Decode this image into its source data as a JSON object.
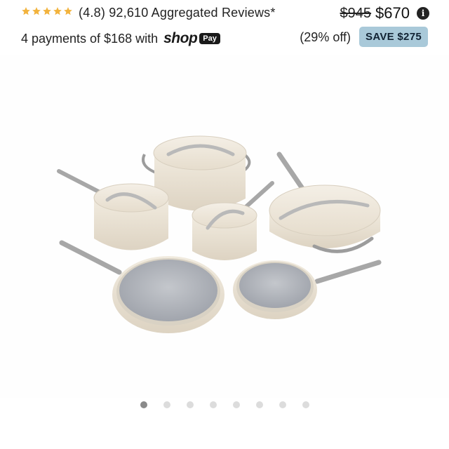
{
  "rating": {
    "stars": 5,
    "score_text": "(4.8)",
    "reviews_text": "92,610 Aggregated Reviews*",
    "star_color": "#f2b33d"
  },
  "price": {
    "original": "$945",
    "current": "$670",
    "info_icon": "info-icon"
  },
  "payments": {
    "text": "4 payments of $168 with",
    "shop_word": "shop",
    "pay_word": "Pay"
  },
  "discount": {
    "percent_text": "(29% off)",
    "save_label": "SAVE $275",
    "badge_color": "#a9c9d9"
  },
  "carousel": {
    "total_dots": 8,
    "active_index": 0
  }
}
